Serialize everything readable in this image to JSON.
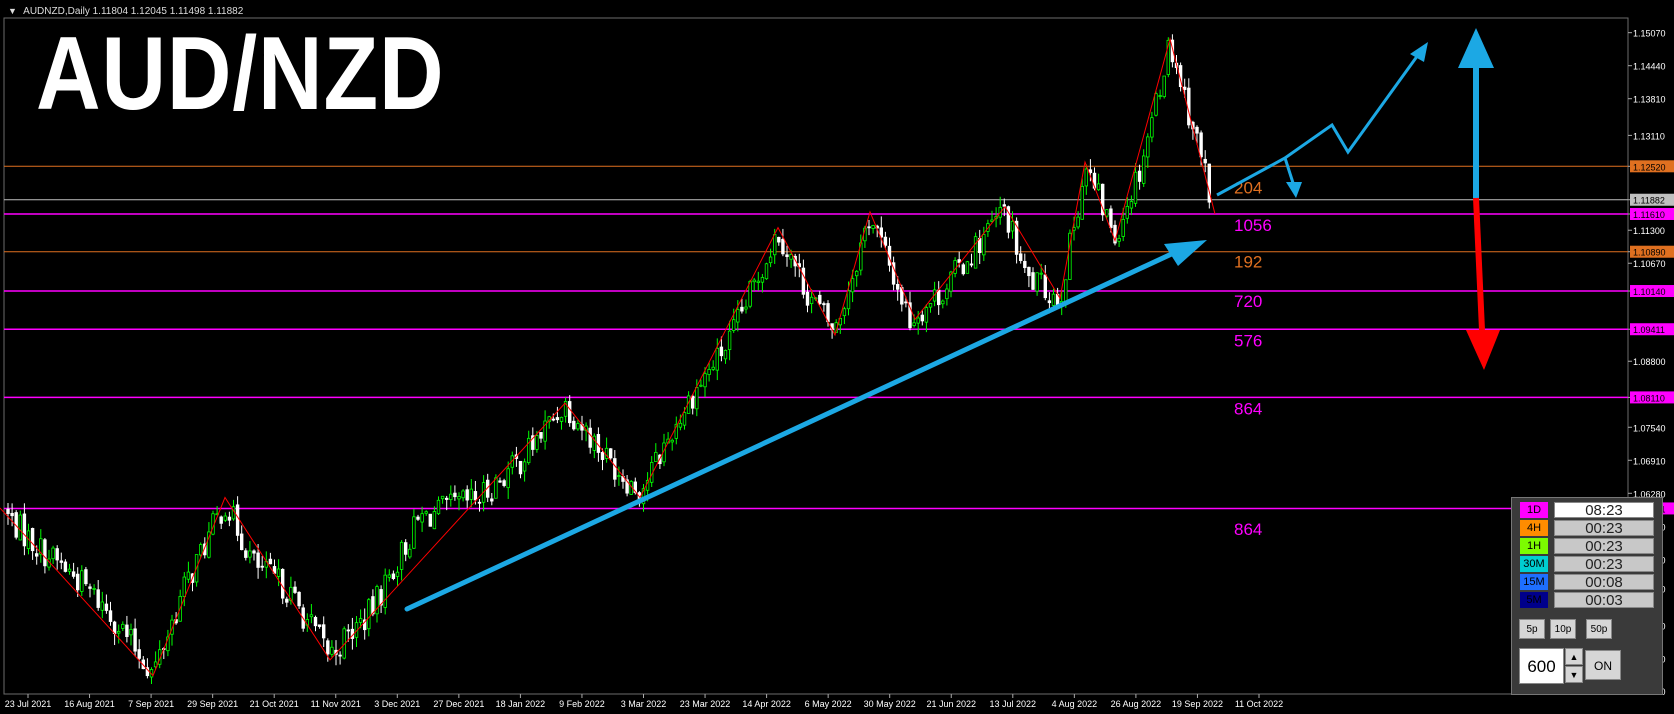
{
  "header": {
    "symbol_info": "AUDNZD,Daily",
    "ohlc": "1.11804 1.12045 1.11498 1.11882"
  },
  "overlay_title": "AUD/NZD",
  "chart_data": {
    "type": "candlestick",
    "symbol": "AUDNZD",
    "timeframe": "Daily",
    "ylim": [
      1.0245,
      1.1535
    ],
    "y_ticks": [
      "1.15070",
      "1.14440",
      "1.13810",
      "1.13110",
      "1.12520",
      "1.11882",
      "1.11610",
      "1.11300",
      "1.10890",
      "1.10670",
      "1.10140",
      "1.09411",
      "1.08800",
      "1.08110",
      "1.07540",
      "1.06910",
      "1.06280",
      "1.05991",
      "1.05650",
      "1.05020",
      "1.04460",
      "1.03760",
      "1.03130",
      "1.02510"
    ],
    "x_ticks": [
      "23 Jul 2021",
      "16 Aug 2021",
      "7 Sep 2021",
      "29 Sep 2021",
      "21 Oct 2021",
      "11 Nov 2021",
      "3 Dec 2021",
      "27 Dec 2021",
      "18 Jan 2022",
      "9 Feb 2022",
      "3 Mar 2022",
      "23 Mar 2022",
      "14 Apr 2022",
      "6 May 2022",
      "30 May 2022",
      "21 Jun 2022",
      "13 Jul 2022",
      "4 Aug 2022",
      "26 Aug 2022",
      "19 Sep 2022",
      "11 Oct 2022"
    ],
    "price_path": [
      [
        0,
        1.06
      ],
      [
        35,
        1.053
      ],
      [
        75,
        1.047
      ],
      [
        110,
        1.04
      ],
      [
        153,
        1.0285
      ],
      [
        185,
        1.045
      ],
      [
        225,
        1.061
      ],
      [
        255,
        1.049
      ],
      [
        285,
        1.045
      ],
      [
        330,
        1.032
      ],
      [
        370,
        1.04
      ],
      [
        420,
        1.058
      ],
      [
        480,
        1.062
      ],
      [
        520,
        1.069
      ],
      [
        565,
        1.08
      ],
      [
        605,
        1.07
      ],
      [
        640,
        1.063
      ],
      [
        690,
        1.081
      ],
      [
        730,
        1.092
      ],
      [
        778,
        1.113
      ],
      [
        805,
        1.102
      ],
      [
        835,
        1.0935
      ],
      [
        870,
        1.116
      ],
      [
        910,
        1.096
      ],
      [
        940,
        1.101
      ],
      [
        1005,
        1.117
      ],
      [
        1025,
        1.104
      ],
      [
        1060,
        1.1
      ],
      [
        1085,
        1.125
      ],
      [
        1115,
        1.112
      ],
      [
        1140,
        1.125
      ],
      [
        1170,
        1.149
      ],
      [
        1200,
        1.128
      ],
      [
        1215,
        1.1161
      ]
    ],
    "zigzag": [
      [
        0,
        1.06
      ],
      [
        153,
        1.028
      ],
      [
        225,
        1.062
      ],
      [
        330,
        1.031
      ],
      [
        565,
        1.08
      ],
      [
        640,
        1.062
      ],
      [
        778,
        1.1135
      ],
      [
        835,
        1.093
      ],
      [
        870,
        1.1165
      ],
      [
        915,
        1.096
      ],
      [
        1005,
        1.1175
      ],
      [
        1060,
        1.1
      ],
      [
        1085,
        1.126
      ],
      [
        1115,
        1.111
      ],
      [
        1170,
        1.1495
      ],
      [
        1215,
        1.1161
      ]
    ],
    "levels": [
      {
        "price": 1.1252,
        "label": "1.12520",
        "color": "#e07020"
      },
      {
        "price": 1.11882,
        "label": "1.11882",
        "color": "#c0c0c0"
      },
      {
        "price": 1.1161,
        "label": "1.11610",
        "color": "#ff00ff"
      },
      {
        "price": 1.1089,
        "label": "1.10890",
        "color": "#e07020"
      },
      {
        "price": 1.1014,
        "label": "1.10140",
        "color": "#ff00ff"
      },
      {
        "price": 1.09411,
        "label": "1.09411",
        "color": "#ff00ff"
      },
      {
        "price": 1.0811,
        "label": "1.08110",
        "color": "#ff00ff"
      },
      {
        "price": 1.05991,
        "label": "1.05991",
        "color": "#ff00ff"
      }
    ],
    "level_annotations": [
      {
        "text": "204",
        "price": 1.1212,
        "color": "#e07020"
      },
      {
        "text": "1056",
        "price": 1.114,
        "color": "#ff00ff"
      },
      {
        "text": "192",
        "price": 1.107,
        "color": "#e07020"
      },
      {
        "text": "720",
        "price": 1.0995,
        "color": "#ff00ff"
      },
      {
        "text": "576",
        "price": 1.092,
        "color": "#ff00ff"
      },
      {
        "text": "864",
        "price": 1.079,
        "color": "#ff00ff"
      },
      {
        "text": "864",
        "price": 1.056,
        "color": "#ff00ff"
      }
    ],
    "colors": {
      "bull_candle": "#00ff00",
      "bear_candle": "#ffffff",
      "zigzag": "#ff0000",
      "forecast_arrow": "#1ca8e4",
      "down_arrow": "#ff0000",
      "grid_text": "#ffffff"
    }
  },
  "timer_panel": {
    "rows": [
      {
        "tf": "1D",
        "time": "08:23",
        "color": "#ff00ff",
        "bg": "#ffffff"
      },
      {
        "tf": "4H",
        "time": "00:23",
        "color": "#ff8c00",
        "bg": "#c8c8c8"
      },
      {
        "tf": "1H",
        "time": "00:23",
        "color": "#7cfc00",
        "bg": "#c8c8c8"
      },
      {
        "tf": "30M",
        "time": "00:23",
        "color": "#00ced1",
        "bg": "#c8c8c8"
      },
      {
        "tf": "15M",
        "time": "00:08",
        "color": "#1e6fff",
        "bg": "#c8c8c8"
      },
      {
        "tf": "5M",
        "time": "00:03",
        "color": "#00008b",
        "bg": "#c8c8c8"
      }
    ],
    "step_buttons": [
      "5p",
      "10p",
      "50p"
    ],
    "pips_value": "600",
    "spin_up": "▲",
    "spin_down": "▼",
    "on_button": "ON"
  }
}
